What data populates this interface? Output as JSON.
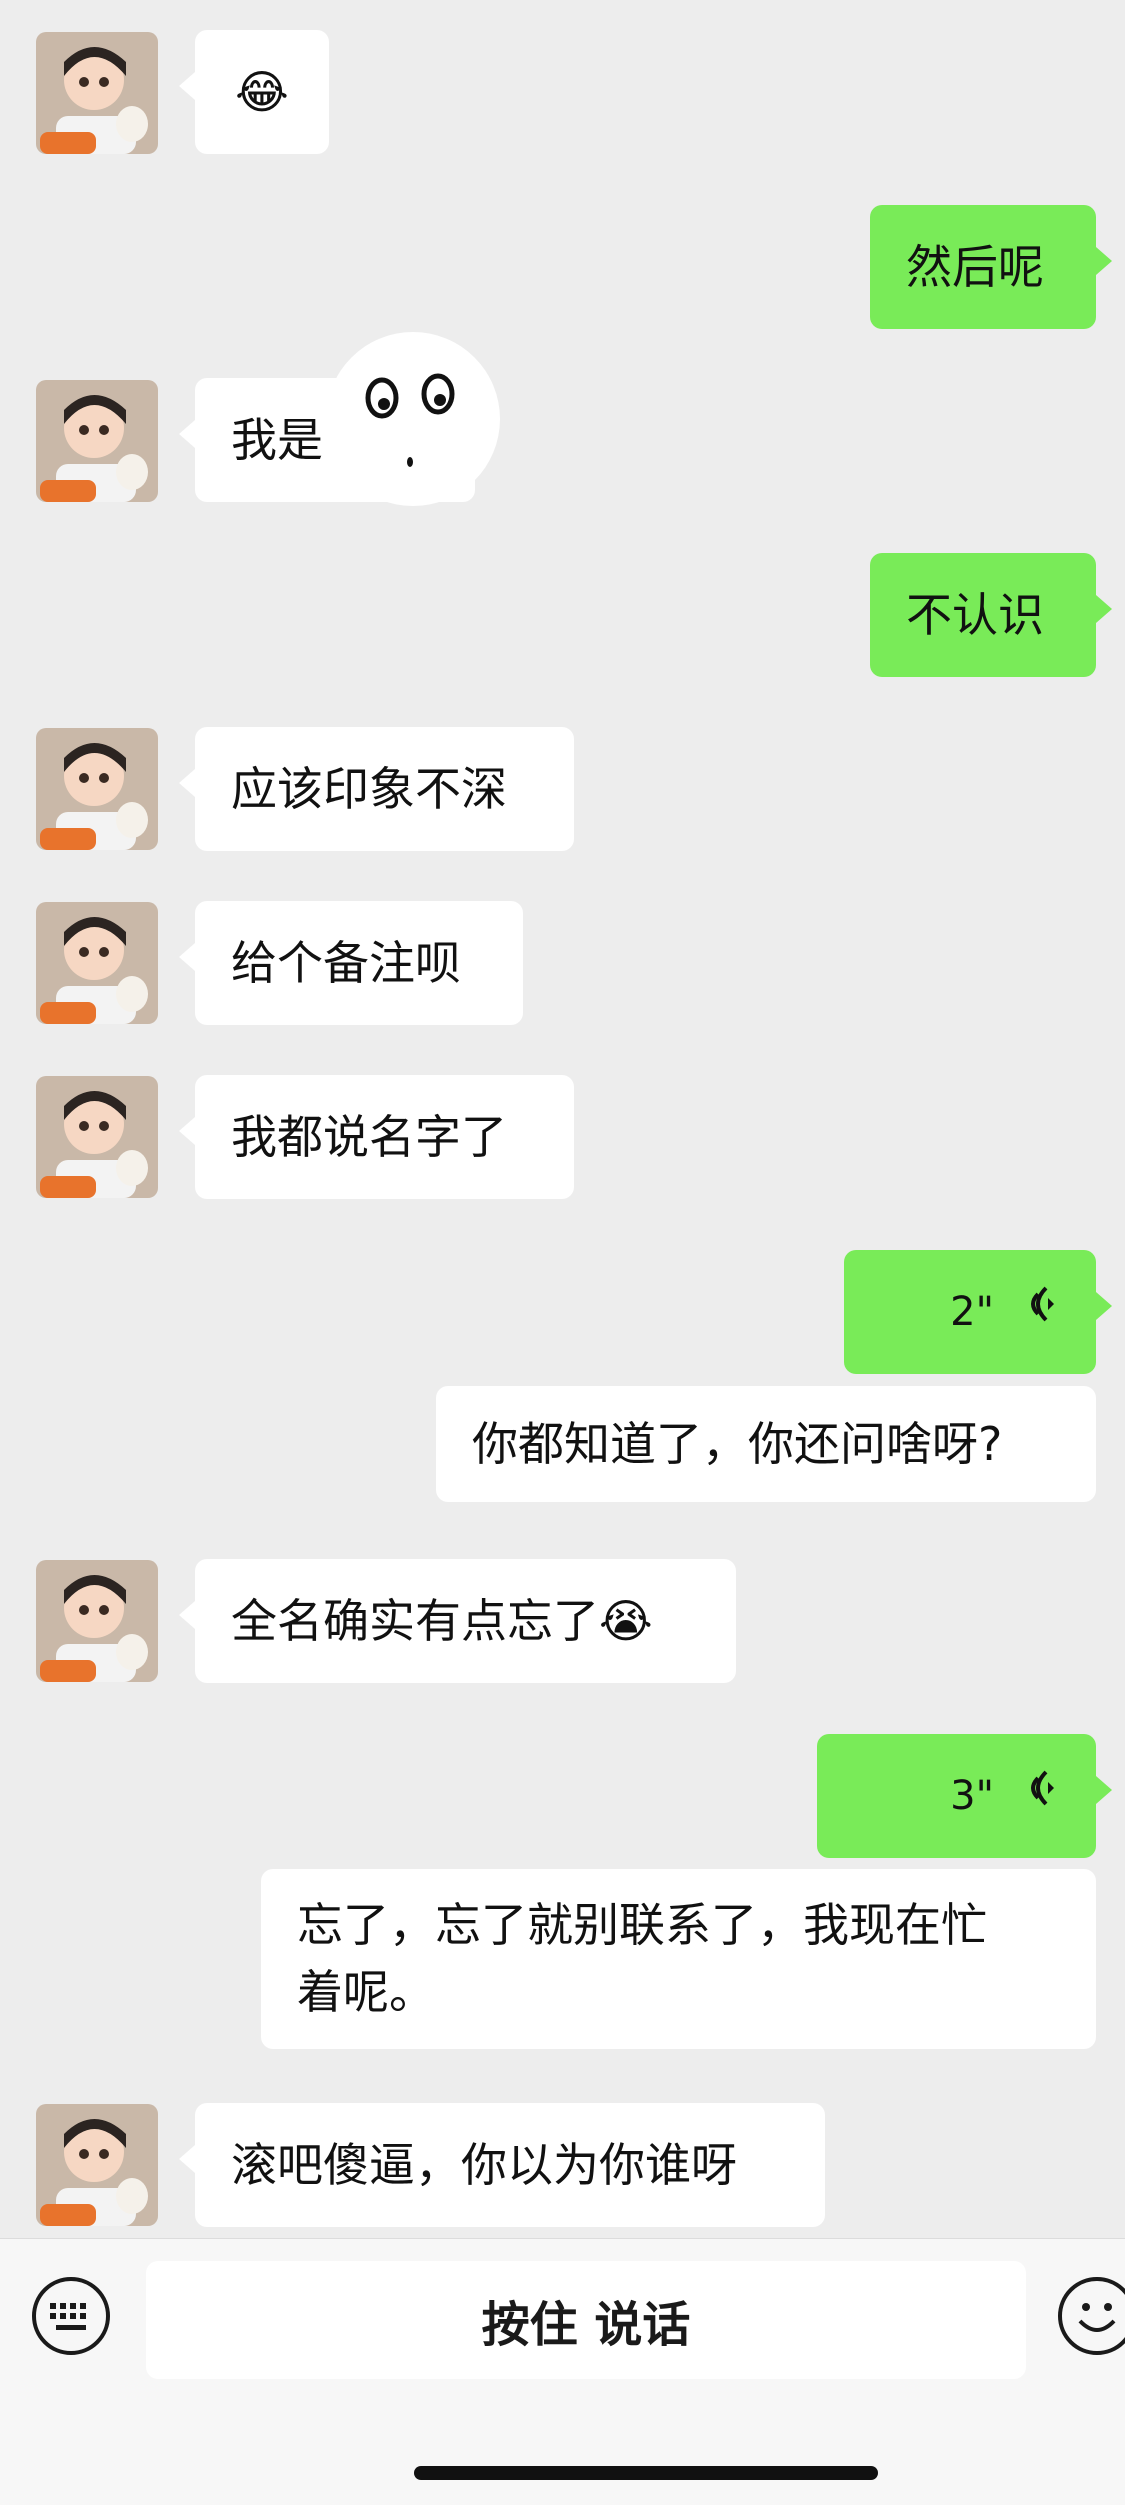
{
  "messages": [
    {
      "side": "in",
      "text": "😂"
    },
    {
      "side": "out",
      "text": "然后呢"
    },
    {
      "side": "in",
      "text": "我是"
    },
    {
      "side": "out",
      "text": "不认识"
    },
    {
      "side": "in",
      "text": "应该印象不深"
    },
    {
      "side": "in",
      "text": "给个备注呗"
    },
    {
      "side": "in",
      "text": "我都说名字了"
    },
    {
      "side": "out",
      "type": "voice",
      "duration": "2\""
    },
    {
      "side": "out",
      "type": "transcript",
      "text": "你都知道了，你还问啥呀?"
    },
    {
      "side": "in",
      "text": "全名确实有点忘了😭"
    },
    {
      "side": "out",
      "type": "voice",
      "duration": "3\""
    },
    {
      "side": "out",
      "type": "transcript",
      "text_line1": "忘了，忘了就别联系了，我现在忙",
      "text_line2": "着呢。"
    },
    {
      "side": "in",
      "text": "滚吧傻逼，你以为你谁呀"
    }
  ],
  "input_bar": {
    "hold_to_talk": "按住 说话",
    "keyboard_icon": "keyboard-icon",
    "emoji_icon": "smiley-icon"
  },
  "colors": {
    "background": "#ededed",
    "outgoing_bubble": "#79eb58",
    "incoming_bubble": "#ffffff"
  }
}
